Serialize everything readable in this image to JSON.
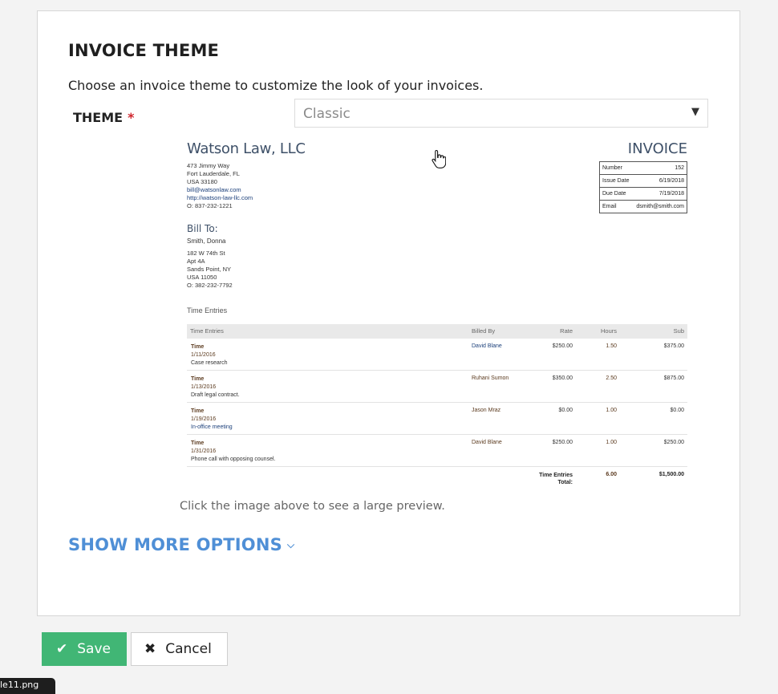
{
  "form": {
    "title": "INVOICE THEME",
    "description": "Choose an invoice theme to customize the look of your invoices.",
    "theme_label": "THEME",
    "required_mark": "*",
    "theme_value": "Classic",
    "hint": "Click the image above to see a large preview.",
    "more_options": "SHOW MORE OPTIONS"
  },
  "invoice": {
    "firm_name": "Watson Law, LLC",
    "firm_lines": [
      "473 Jimmy Way",
      "Fort Lauderdale, FL",
      "USA 33180",
      "bill@watsonlaw.com",
      "http://watson-law-llc.com",
      "O: 837-232-1221"
    ],
    "heading": "INVOICE",
    "meta": [
      {
        "label": "Number",
        "value": "152"
      },
      {
        "label": "Issue Date",
        "value": "6/19/2018"
      },
      {
        "label": "Due Date",
        "value": "7/19/2018"
      },
      {
        "label": "Email",
        "value": "dsmith@smith.com"
      }
    ],
    "bill_to_label": "Bill To:",
    "bill_to_name": "Smith, Donna",
    "bill_to_lines": [
      "182 W 74th St",
      "Apt 4A",
      "Sands Point, NY",
      "USA 11050",
      "O: 382-232-7792"
    ],
    "section_title": "Time Entries",
    "columns": [
      "Time Entries",
      "Billed By",
      "Rate",
      "Hours",
      "Sub"
    ],
    "rows": [
      {
        "kind": "Time",
        "date": "1/11/2016",
        "note": "Case research",
        "billed_by": "David Blane",
        "rate": "$250.00",
        "hours": "1.50",
        "sub": "$375.00"
      },
      {
        "kind": "Time",
        "date": "1/13/2016",
        "note": "Draft legal contract.",
        "billed_by": "Ruhani Sumon",
        "rate": "$350.00",
        "hours": "2.50",
        "sub": "$875.00"
      },
      {
        "kind": "Time",
        "date": "1/19/2016",
        "note": "In-office meeting",
        "billed_by": "Jason Mraz",
        "rate": "$0.00",
        "hours": "1.00",
        "sub": "$0.00"
      },
      {
        "kind": "Time",
        "date": "1/31/2016",
        "note": "Phone call with opposing counsel.",
        "billed_by": "David Blane",
        "rate": "$250.00",
        "hours": "1.00",
        "sub": "$250.00"
      }
    ],
    "total_label_1": "Time Entries",
    "total_label_2": "Total:",
    "total_hours": "6.00",
    "total_sub": "$1,500.00"
  },
  "buttons": {
    "save": "Save",
    "cancel": "Cancel"
  },
  "tooltip": "le11.png",
  "icons": {
    "caret": "caret-down-icon",
    "chevron": "chevron-down-icon",
    "check": "check-icon",
    "close": "close-icon",
    "cursor": "hand-cursor-icon"
  },
  "colors": {
    "accent_link": "#4f8fd6",
    "save_button": "#41b675",
    "required": "#d0252d"
  }
}
